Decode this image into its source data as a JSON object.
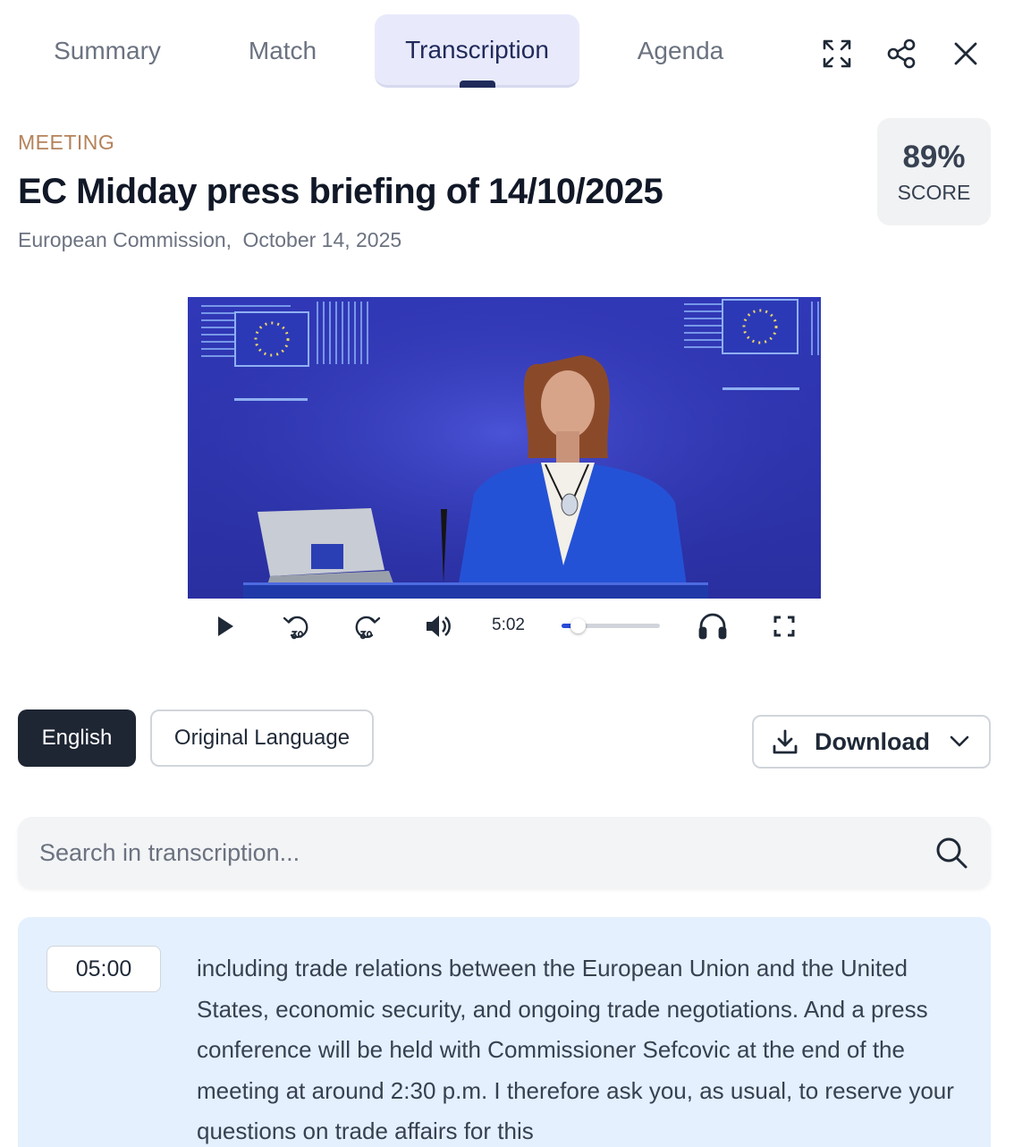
{
  "tabs": [
    {
      "label": "Summary",
      "active": false
    },
    {
      "label": "Match",
      "active": false
    },
    {
      "label": "Transcription",
      "active": true
    },
    {
      "label": "Agenda",
      "active": false
    }
  ],
  "header_tools": {
    "expand_icon": "expand-arrows-icon",
    "share_icon": "share-icon",
    "close_icon": "close-icon"
  },
  "meeting": {
    "type_label": "MEETING",
    "title": "EC Midday press briefing of 14/10/2025",
    "organization": "European Commission,",
    "date": "October 14, 2025"
  },
  "score": {
    "value": "89%",
    "label": "SCORE"
  },
  "video": {
    "time": "5:02",
    "progress": 0.17
  },
  "language": {
    "english_label": "English",
    "original_label": "Original Language",
    "selected": "English"
  },
  "download": {
    "label": "Download"
  },
  "search": {
    "placeholder": "Search in transcription..."
  },
  "transcript": [
    {
      "timestamp": "05:00",
      "text": "including trade relations between the European Union and the United States, economic security, and ongoing trade negotiations. And a press conference will be held with Commissioner Sefcovic at the end of the meeting at around 2:30 p.m. I therefore ask you, as usual, to reserve your questions on trade affairs for this"
    }
  ],
  "colors": {
    "accent": "#1f2a5a",
    "active_tab_bg": "#e8eafb",
    "eyebrow": "#b5825a",
    "segment_bg": "#e4f0fd",
    "primary_button": "#1e2533"
  }
}
